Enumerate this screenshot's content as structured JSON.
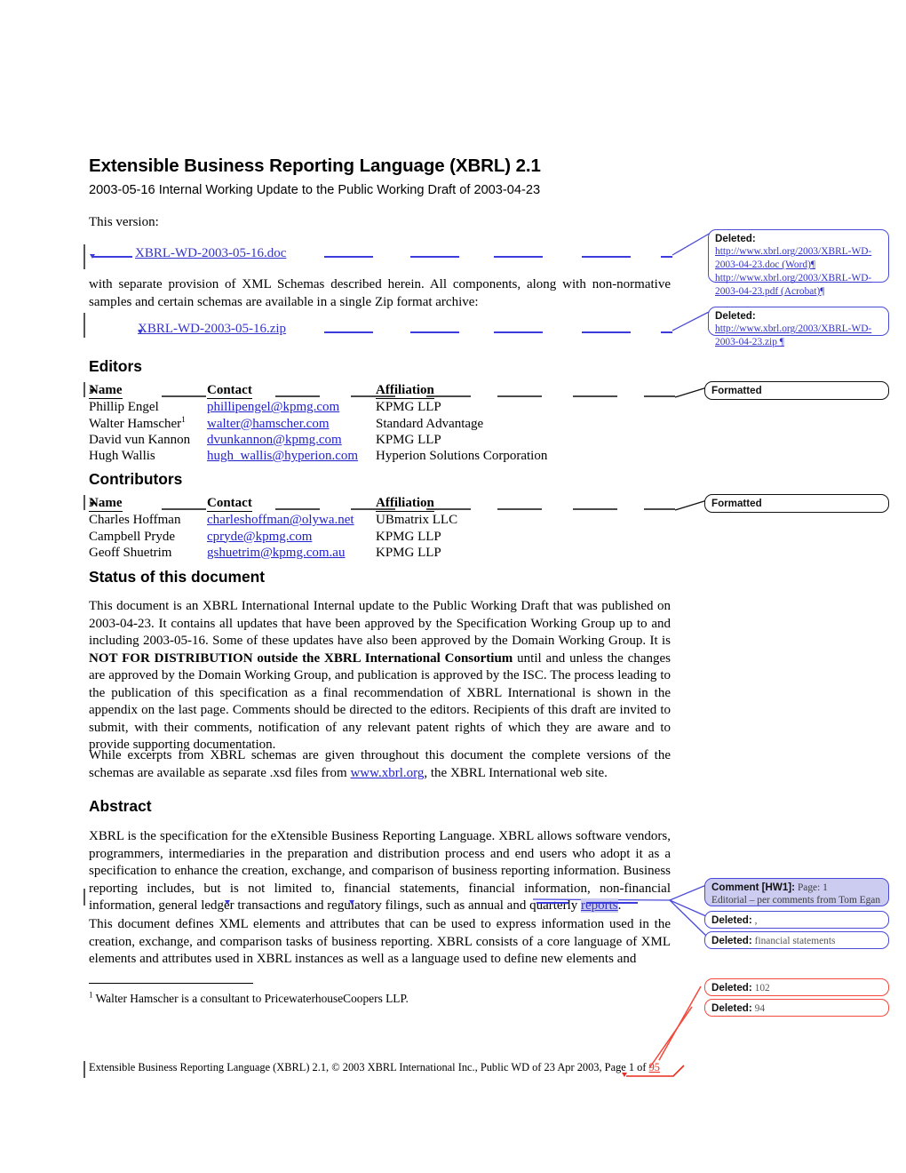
{
  "document": {
    "title": "Extensible Business Reporting Language (XBRL) 2.1",
    "subtitle": "2003-05-16 Internal Working Update to the Public Working Draft of 2003-04-23",
    "this_version_label": "This version:",
    "this_version_link": "XBRL-WD-2003-05-16.doc",
    "zip_intro": "with separate provision of XML Schemas described herein.  All components, along with non-normative samples and certain schemas are available in a single Zip format archive:",
    "zip_link": "XBRL-WD-2003-05-16.zip"
  },
  "editors": {
    "heading": "Editors",
    "columns": [
      "Name",
      "Contact",
      "Affiliation"
    ],
    "rows": [
      {
        "name": "Phillip Engel",
        "name_sup": "",
        "contact": "phillipengel@kpmg.com",
        "affiliation": "KPMG LLP"
      },
      {
        "name": "Walter Hamscher",
        "name_sup": "1",
        "contact": "walter@hamscher.com",
        "affiliation": "Standard Advantage"
      },
      {
        "name": "David vun Kannon",
        "name_sup": "",
        "contact": "dvunkannon@kpmg.com",
        "affiliation": "KPMG LLP"
      },
      {
        "name": "Hugh Wallis",
        "name_sup": "",
        "contact": "hugh_wallis@hyperion.com",
        "affiliation": "Hyperion Solutions Corporation"
      }
    ]
  },
  "contributors": {
    "heading": "Contributors",
    "columns": [
      "Name",
      "Contact",
      "Affiliation"
    ],
    "rows": [
      {
        "name": "Charles Hoffman",
        "contact": "charleshoffman@olywa.net",
        "affiliation": "UBmatrix LLC"
      },
      {
        "name": "Campbell Pryde",
        "contact": "cpryde@kpmg.com",
        "affiliation": "KPMG LLP"
      },
      {
        "name": "Geoff Shuetrim",
        "contact": "gshuetrim@kpmg.com.au",
        "affiliation": "KPMG LLP"
      }
    ]
  },
  "status": {
    "heading": "Status of this document",
    "para1_before": "This document is an XBRL International Internal update to the Public Working Draft that was published on 2003-04-23. It contains all updates that have been approved by the Specification Working Group up to and including 2003-05-16. Some of these updates have also been approved by the Domain Working Group. It is ",
    "para1_bold": "NOT FOR DISTRIBUTION outside the XBRL International Consortium",
    "para1_after": " until and unless the changes are approved by the Domain Working Group, and publication is approved by the ISC.  The process leading to the publication of this specification as a final recommendation of XBRL International is shown in the appendix on the last page.  Comments should be directed to the editors.  Recipients of this draft are invited to submit, with their comments, notification of any relevant patent rights of which they are aware and to provide supporting documentation.",
    "para2_before": "While excerpts from XBRL schemas are given throughout this document the complete versions of the schemas are available as separate .xsd files from ",
    "para2_link": "www.xbrl.org",
    "para2_after": ", the XBRL International web site."
  },
  "abstract": {
    "heading": "Abstract",
    "para1_before": "XBRL is the specification for the eXtensible Business Reporting Language. XBRL allows software vendors, programmers, intermediaries in the preparation and distribution process and end users who adopt it as a specification to enhance the creation, exchange, and comparison of business reporting information. Business reporting includes, but is not limited to, financial statements, financial information, non-financial information, general ledger transactions and regulatory filings, such as annual and quarterly ",
    "para1_highlight": "reports",
    "para1_after": ".",
    "para2": "This document defines XML elements and attributes that can be used to express information used in the creation, exchange, and comparison tasks of business reporting. XBRL consists of a core language of XML elements and attributes used in XBRL instances as well as a language used to define new elements and"
  },
  "footnote": {
    "marker": "1",
    "text": " Walter Hamscher is a consultant to PricewaterhouseCoopers LLP."
  },
  "footer": {
    "text_before": "Extensible Business Reporting Language (XBRL) 2.1, © 2003 XBRL International Inc., Public WD of 23 Apr 2003, Page 1 of ",
    "page_total_inserted": "95"
  },
  "markup_balloons": [
    {
      "id": "deleted-doc-links",
      "kind": "deleted",
      "style": "blue",
      "label": "Deleted:",
      "value": "http://www.xbrl.org/2003/XBRL-WD-2003-04-23.doc (Word)¶ http://www.xbrl.org/2003/XBRL-WD-2003-04-23.pdf  (Acrobat)¶"
    },
    {
      "id": "deleted-zip-link",
      "kind": "deleted",
      "style": "blue",
      "label": "Deleted:",
      "value": "http://www.xbrl.org/2003/XBRL-WD-2003-04-23.zip ¶"
    },
    {
      "id": "formatted-editors",
      "kind": "formatted",
      "style": "black",
      "label": "Formatted",
      "value": ""
    },
    {
      "id": "formatted-contributors",
      "kind": "formatted",
      "style": "black",
      "label": "Formatted",
      "value": ""
    },
    {
      "id": "comment-hw1",
      "kind": "comment",
      "style": "comment",
      "label": "Comment [HW1]:",
      "value": "Page: 1",
      "value2": "Editorial – per comments from Tom Egan"
    },
    {
      "id": "deleted-comma",
      "kind": "deleted",
      "style": "blue",
      "label": "Deleted:",
      "value": ","
    },
    {
      "id": "deleted-financial-statements",
      "kind": "deleted",
      "style": "blue",
      "label": "Deleted:",
      "value": "financial statements"
    },
    {
      "id": "deleted-102",
      "kind": "deleted",
      "style": "red",
      "label": "Deleted:",
      "value": "102"
    },
    {
      "id": "deleted-94",
      "kind": "deleted",
      "style": "red",
      "label": "Deleted:",
      "value": "94"
    }
  ],
  "colors": {
    "insertion_blue": "#3333cc",
    "deletion_red": "#e82b1c",
    "comment_fill": "#ccccf0",
    "changebar_gray": "#565656"
  }
}
